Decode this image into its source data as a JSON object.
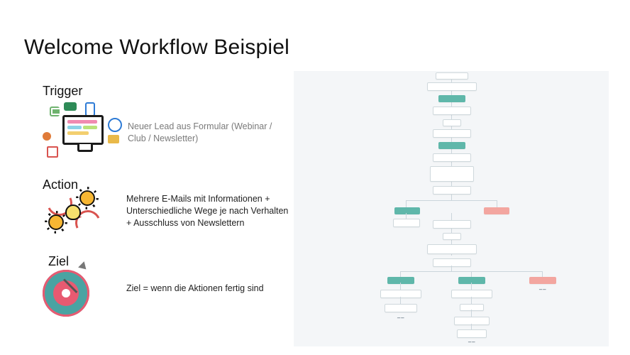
{
  "title": "Welcome Workflow Beispiel",
  "trigger": {
    "heading": "Trigger",
    "text": "Neuer Lead aus Formular (Webinar / Club / Newsletter)"
  },
  "action": {
    "heading": "Action",
    "text": "Mehrere E-Mails mit Informationen + Unterschiedliche Wege je nach Verhalten + Ausschluss von Newslettern"
  },
  "ziel": {
    "heading": "Ziel",
    "text": "Ziel = wenn die Aktionen fertig sind"
  }
}
